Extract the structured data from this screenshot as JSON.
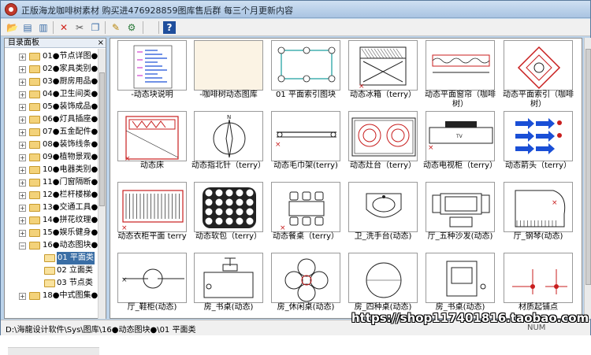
{
  "window": {
    "title": "正版海龙咖啡树素材 购买进476928859图库售后群 每三个月更新内容"
  },
  "toolbar": {
    "buttons": [
      {
        "name": "open-icon",
        "glyph": "📂",
        "color": "#c8962c"
      },
      {
        "name": "view-icon",
        "glyph": "▤",
        "color": "#3c6ea8"
      },
      {
        "name": "list-icon",
        "glyph": "▥",
        "color": "#3c6ea8"
      },
      {
        "name": "delete-icon",
        "glyph": "✕",
        "color": "#d0241c"
      },
      {
        "name": "cut-icon",
        "glyph": "✂",
        "color": "#555555"
      },
      {
        "name": "copy-icon",
        "glyph": "❐",
        "color": "#3c6ea8"
      },
      {
        "name": "edit-icon",
        "glyph": "✎",
        "color": "#b8860b"
      },
      {
        "name": "tools-icon",
        "glyph": "⚙",
        "color": "#2a7a3a"
      },
      {
        "name": "help-icon",
        "glyph": "?",
        "color": "#1f4e9c"
      }
    ]
  },
  "sidebar": {
    "header": "目录面板",
    "close": "×",
    "items": [
      {
        "label": "01●节点详图●",
        "level": 0,
        "expander": "+"
      },
      {
        "label": "02●家具类别●",
        "level": 0,
        "expander": "+"
      },
      {
        "label": "03●厨房用品●",
        "level": 0,
        "expander": "+"
      },
      {
        "label": "04●卫生间类●",
        "level": 0,
        "expander": "+"
      },
      {
        "label": "05●装饰成品●",
        "level": 0,
        "expander": "+"
      },
      {
        "label": "06●灯具插座●",
        "level": 0,
        "expander": "+"
      },
      {
        "label": "07●五金配件●",
        "level": 0,
        "expander": "+"
      },
      {
        "label": "08●装饰线条●",
        "level": 0,
        "expander": "+"
      },
      {
        "label": "09●植物景观●",
        "level": 0,
        "expander": "+"
      },
      {
        "label": "10●电器类别●",
        "level": 0,
        "expander": "+"
      },
      {
        "label": "11●门窗隔断●",
        "level": 0,
        "expander": "+"
      },
      {
        "label": "12●栏杆楼梯●",
        "level": 0,
        "expander": "+"
      },
      {
        "label": "13●交通工具●",
        "level": 0,
        "expander": "+"
      },
      {
        "label": "14●拼花纹理●",
        "level": 0,
        "expander": "+"
      },
      {
        "label": "15●娱乐健身●",
        "level": 0,
        "expander": "+"
      },
      {
        "label": "16●动态图块●",
        "level": 0,
        "expander": "−"
      },
      {
        "label": "01 平面类",
        "level": 1,
        "selected": true
      },
      {
        "label": "02 立面类",
        "level": 1
      },
      {
        "label": "03 节点类",
        "level": 1
      },
      {
        "label": "18●中式图集●",
        "level": 0,
        "expander": "+"
      }
    ]
  },
  "grid": {
    "items": [
      {
        "caption": "-动态块说明",
        "kind": "doc"
      },
      {
        "caption": "-咖啡树动态图库",
        "kind": "blank"
      },
      {
        "caption": "01 平面索引图块",
        "kind": "index"
      },
      {
        "caption": "动态冰箱（terry）",
        "kind": "fridge"
      },
      {
        "caption": "动态平面窗帘（咖啡树）",
        "kind": "curtain"
      },
      {
        "caption": "动态平面索引（咖啡树）",
        "kind": "diamond"
      },
      {
        "caption": "动态床",
        "kind": "bed"
      },
      {
        "caption": "动态指北针（terry）",
        "kind": "compass"
      },
      {
        "caption": "动态毛巾架(terry)",
        "kind": "towel"
      },
      {
        "caption": "动态灶台（terry）",
        "kind": "stove"
      },
      {
        "caption": "动态电视柜（terry）",
        "kind": "tv"
      },
      {
        "caption": "动态箭头（terry）",
        "kind": "arrows"
      },
      {
        "caption": "动态衣柜平面 terry",
        "kind": "wardrobe"
      },
      {
        "caption": "动态软包（terry）",
        "kind": "pattern"
      },
      {
        "caption": "动态餐桌（terry）",
        "kind": "dining"
      },
      {
        "caption": "卫_洗手台(动态)",
        "kind": "basin"
      },
      {
        "caption": "厅_五种沙发(动态)",
        "kind": "sofa"
      },
      {
        "caption": "厅_钢琴(动态)",
        "kind": "piano"
      },
      {
        "caption": "厅_鞋柜(动态)",
        "kind": "shoe"
      },
      {
        "caption": "房_书桌(动态)",
        "kind": "desk"
      },
      {
        "caption": "房_休闲桌(动态)",
        "kind": "leisure"
      },
      {
        "caption": "房_四种桌(动态)",
        "kind": "circle"
      },
      {
        "caption": "房_书桌(动态)",
        "kind": "chair"
      },
      {
        "caption": "材质起铺点",
        "kind": "material"
      }
    ]
  },
  "status": {
    "path": "D:\\海龍设计软件\\Sys\\图库\\16●动态图块●\\01 平面类",
    "num": "NUM"
  },
  "watermark": "https://shop117401816.taobao.com"
}
